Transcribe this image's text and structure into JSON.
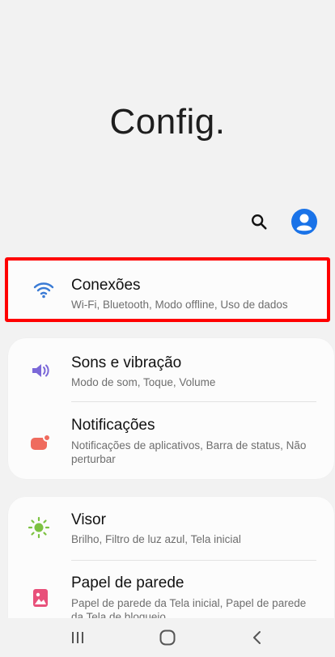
{
  "header": {
    "title": "Config."
  },
  "actions": {
    "search_icon": "search-icon",
    "profile_icon": "account-circle-icon",
    "accent_color": "#1a73e8"
  },
  "sections": [
    {
      "items": [
        {
          "title": "Conexões",
          "subtitle": "Wi-Fi, Bluetooth, Modo offline, Uso de dados",
          "icon": "wifi-icon",
          "icon_color": "#3a7bd5",
          "highlighted": true,
          "highlight_color": "#ff0000"
        }
      ]
    },
    {
      "items": [
        {
          "title": "Sons e vibração",
          "subtitle": "Modo de som, Toque, Volume",
          "icon": "volume-icon",
          "icon_color": "#7b68d8"
        },
        {
          "title": "Notificações",
          "subtitle": "Notificações de aplicativos, Barra de status, Não perturbar",
          "icon": "notification-icon",
          "icon_color": "#ef6b5e"
        }
      ]
    },
    {
      "items": [
        {
          "title": "Visor",
          "subtitle": "Brilho, Filtro de luz azul, Tela inicial",
          "icon": "brightness-icon",
          "icon_color": "#7dc242"
        },
        {
          "title": "Papel de parede",
          "subtitle": "Papel de parede da Tela inicial, Papel de parede da Tela de bloqueio",
          "icon": "wallpaper-icon",
          "icon_color": "#e8507a"
        }
      ]
    }
  ],
  "navbar": {
    "recent_icon": "recent-apps-icon",
    "home_icon": "home-icon",
    "back_icon": "back-icon"
  }
}
